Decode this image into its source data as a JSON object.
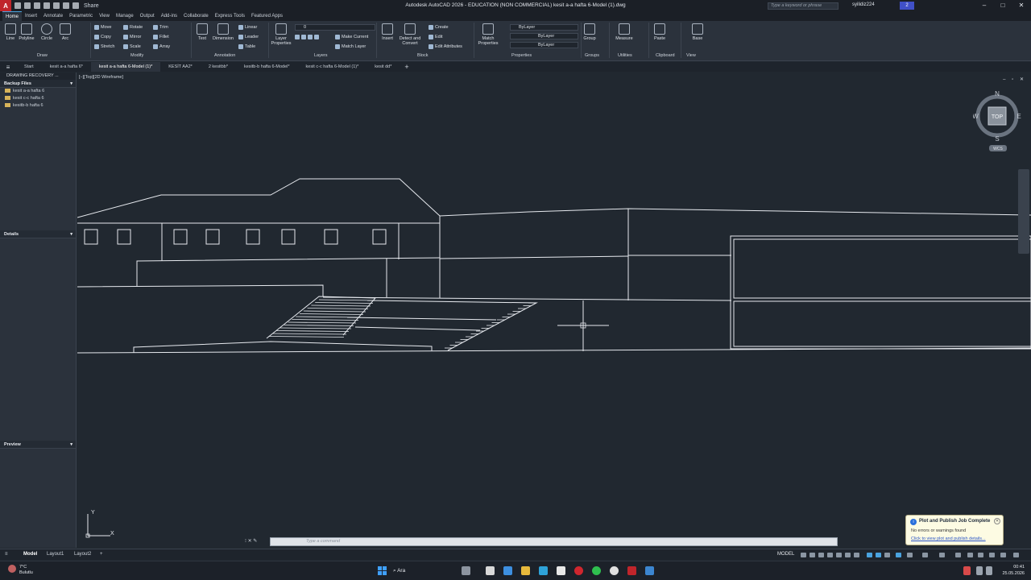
{
  "titlebar": {
    "logo": "A",
    "share": "Share",
    "title": "Autodesk AutoCAD 2026 - EDUCATION (NON COMMERCIAL)   kesit a-a hafta 6-Model (1).dwg",
    "search_placeholder": "Type a keyword or phrase",
    "user": "syilidiz224",
    "help_badge": "2",
    "minimize": "–",
    "maximize": "□",
    "close": "✕"
  },
  "ribbon_tabs": [
    "Home",
    "Insert",
    "Annotate",
    "Parametric",
    "View",
    "Manage",
    "Output",
    "Add-ins",
    "Collaborate",
    "Express Tools",
    "Featured Apps"
  ],
  "ribbon": {
    "draw": {
      "title": "Draw",
      "line": "Line",
      "polyline": "Polyline",
      "circle": "Circle",
      "arc": "Arc"
    },
    "modify": {
      "title": "Modify",
      "move": "Move",
      "rotate": "Rotate",
      "trim": "Trim",
      "copy": "Copy",
      "mirror": "Mirror",
      "fillet": "Fillet",
      "stretch": "Stretch",
      "scale": "Scale",
      "array": "Array"
    },
    "annotation": {
      "title": "Annotation",
      "text": "Text",
      "dimension": "Dimension",
      "linear": "Linear",
      "leader": "Leader",
      "table": "Table"
    },
    "layers": {
      "title": "Layers",
      "layer_properties": "Layer Properties",
      "layer_value": "0",
      "make_current": "Make Current",
      "match_layer": "Match Layer"
    },
    "block": {
      "title": "Block",
      "insert": "Insert",
      "detect": "Detect and Convert",
      "create": "Create",
      "edit": "Edit",
      "edit_attributes": "Edit Attributes"
    },
    "properties": {
      "title": "Properties",
      "match": "Match Properties",
      "bylayer1": "ByLayer",
      "bylayer2": "ByLayer",
      "bylayer3": "ByLayer"
    },
    "groups": {
      "title": "Groups",
      "group": "Group"
    },
    "utilities": {
      "title": "Utilities",
      "measure": "Measure"
    },
    "clipboard": {
      "title": "Clipboard",
      "paste": "Paste"
    },
    "view": {
      "title": "View",
      "base": "Base"
    }
  },
  "doc_tabs": [
    "Start",
    "kesit a-a hafta 6*",
    "kesit a-a hafta 6-Model (1)*",
    "KESİT AA2*",
    "2 kesitbb*",
    "kesitb-b hafta 6-Model*",
    "kesit c-c hafta 6-Model (1)*",
    "kesit dd*"
  ],
  "palette": {
    "title": "DRAWING RECOVERY ...",
    "backup_files": "Backup Files",
    "files": [
      "kesit a-a hafta 6",
      "kesit c-c hafta 6",
      "kesitb-b hafta 6"
    ],
    "details": "Details",
    "preview": "Preview"
  },
  "viewport": {
    "label": "[–][Top][2D Wireframe]",
    "viewcube": {
      "n": "N",
      "s": "S",
      "e": "E",
      "w": "W",
      "face": "TOP",
      "wcs": "WCS"
    },
    "ucs": {
      "x": "X",
      "y": "Y"
    }
  },
  "command": {
    "placeholder": "Type a command"
  },
  "notification": {
    "title": "Plot and Publish Job Complete",
    "message": "No errors or warnings found",
    "link": "Click to view plot and publish details..."
  },
  "statusbar": {
    "layouts": [
      "Model",
      "Layout1",
      "Layout2"
    ],
    "model": "MODEL"
  },
  "taskbar": {
    "temp": "7°C",
    "condition": "Bulutlu",
    "search": "Ara",
    "time": "00:41",
    "date": "25.05.2026"
  },
  "colors": {
    "accent": "#4aa3df",
    "background": "#212830",
    "ribbon": "#2b323c",
    "lines": "#e6e9ee"
  }
}
